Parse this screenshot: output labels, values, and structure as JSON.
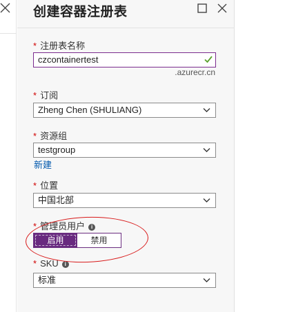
{
  "blade": {
    "title": "创建容器注册表"
  },
  "form": {
    "registry_name": {
      "label": "注册表名称",
      "value": "czcontainertest",
      "suffix": ".azurecr.cn"
    },
    "subscription": {
      "label": "订阅",
      "value": "Zheng Chen (SHULIANG)"
    },
    "resource_group": {
      "label": "资源组",
      "value": "testgroup",
      "new_link": "新建"
    },
    "location": {
      "label": "位置",
      "value": "中国北部"
    },
    "admin_user": {
      "label": "管理员用户",
      "enable_label": "启用",
      "disable_label": "禁用"
    },
    "sku": {
      "label": "SKU",
      "value": "标准"
    }
  },
  "icons": {
    "close": "close-icon",
    "maximize": "maximize-icon",
    "check": "check-icon",
    "chevron": "chevron-down-icon",
    "info": "info-icon"
  },
  "colors": {
    "accent": "#682a7f",
    "required": "#d00000",
    "valid_check": "#5aa02c",
    "link": "#0058ad",
    "annotation": "#d81818"
  }
}
